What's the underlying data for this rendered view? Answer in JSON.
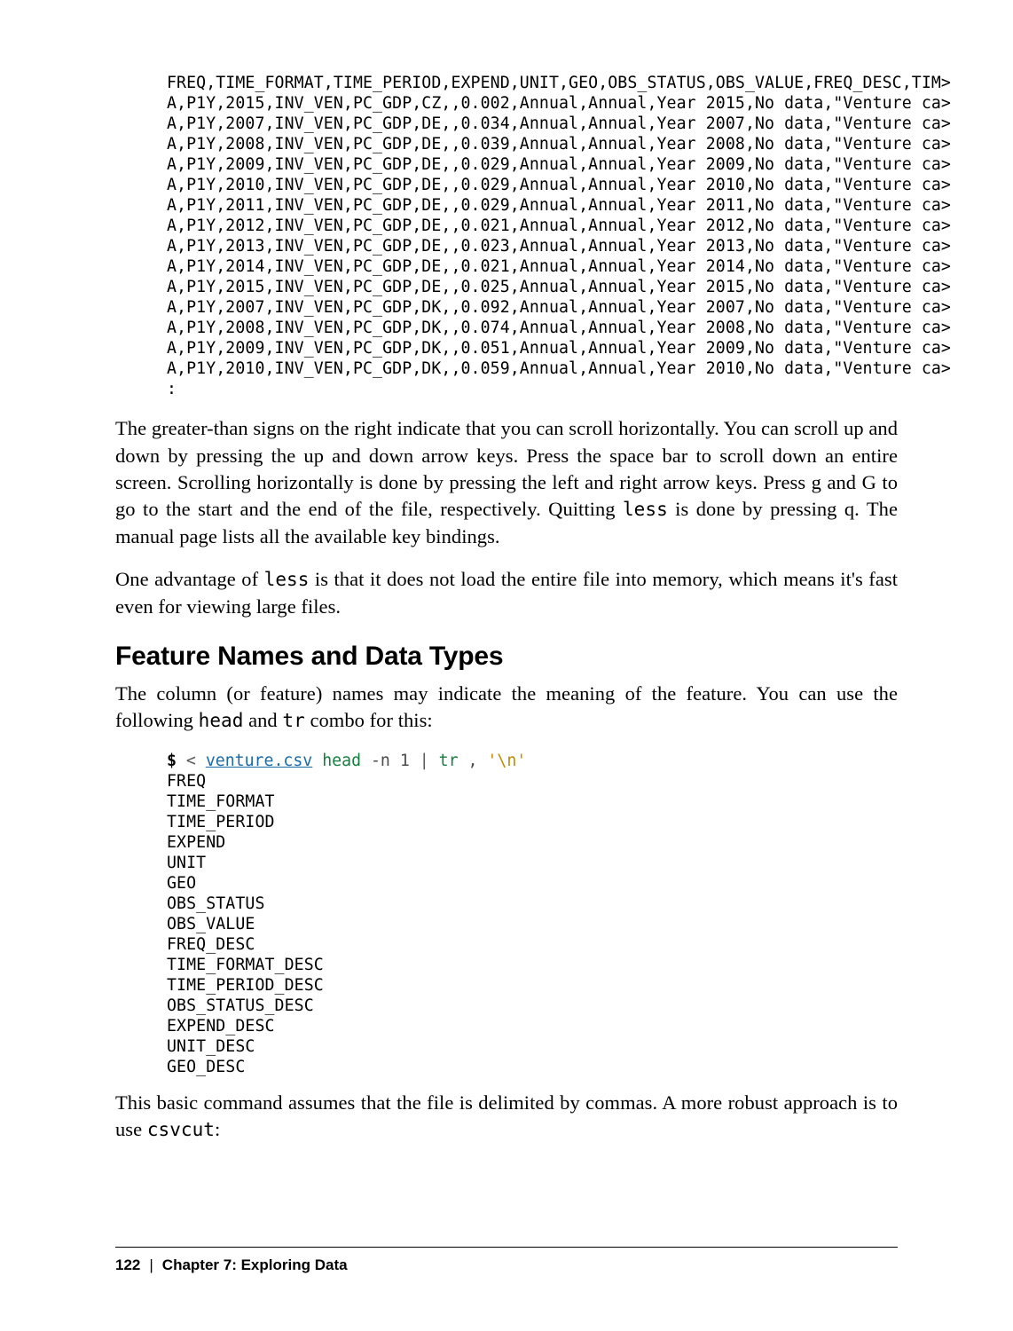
{
  "code1": "FREQ,TIME_FORMAT,TIME_PERIOD,EXPEND,UNIT,GEO,OBS_STATUS,OBS_VALUE,FREQ_DESC,TIM>\nA,P1Y,2015,INV_VEN,PC_GDP,CZ,,0.002,Annual,Annual,Year 2015,No data,\"Venture ca>\nA,P1Y,2007,INV_VEN,PC_GDP,DE,,0.034,Annual,Annual,Year 2007,No data,\"Venture ca>\nA,P1Y,2008,INV_VEN,PC_GDP,DE,,0.039,Annual,Annual,Year 2008,No data,\"Venture ca>\nA,P1Y,2009,INV_VEN,PC_GDP,DE,,0.029,Annual,Annual,Year 2009,No data,\"Venture ca>\nA,P1Y,2010,INV_VEN,PC_GDP,DE,,0.029,Annual,Annual,Year 2010,No data,\"Venture ca>\nA,P1Y,2011,INV_VEN,PC_GDP,DE,,0.029,Annual,Annual,Year 2011,No data,\"Venture ca>\nA,P1Y,2012,INV_VEN,PC_GDP,DE,,0.021,Annual,Annual,Year 2012,No data,\"Venture ca>\nA,P1Y,2013,INV_VEN,PC_GDP,DE,,0.023,Annual,Annual,Year 2013,No data,\"Venture ca>\nA,P1Y,2014,INV_VEN,PC_GDP,DE,,0.021,Annual,Annual,Year 2014,No data,\"Venture ca>\nA,P1Y,2015,INV_VEN,PC_GDP,DE,,0.025,Annual,Annual,Year 2015,No data,\"Venture ca>\nA,P1Y,2007,INV_VEN,PC_GDP,DK,,0.092,Annual,Annual,Year 2007,No data,\"Venture ca>\nA,P1Y,2008,INV_VEN,PC_GDP,DK,,0.074,Annual,Annual,Year 2008,No data,\"Venture ca>\nA,P1Y,2009,INV_VEN,PC_GDP,DK,,0.051,Annual,Annual,Year 2009,No data,\"Venture ca>\nA,P1Y,2010,INV_VEN,PC_GDP,DK,,0.059,Annual,Annual,Year 2010,No data,\"Venture ca>\n:",
  "para1_a": "The greater-than signs on the right indicate that you can scroll horizontally. You can scroll up and down by pressing the up and down arrow keys. Press the space bar to scroll down an entire screen. Scrolling horizontally is done by pressing the left and right arrow keys. Press g and G to go to the start and the end of the file, respectively. Quitting ",
  "para1_code1": "less",
  "para1_b": " is done by pressing q. The manual page lists all the available key bindings.",
  "para2_a": "One advantage of ",
  "para2_code1": "less",
  "para2_b": " is that it does not load the entire file into memory, which means it's fast even for viewing large files.",
  "heading": "Feature Names and Data Types",
  "para3_a": "The column (or feature) names may indicate the meaning of the feature. You can use the following ",
  "para3_code1": "head",
  "para3_b": " and ",
  "para3_code2": "tr",
  "para3_c": " combo for this:",
  "cmd": {
    "prompt": "$",
    "op": "<",
    "filename": "venture.csv",
    "cmd1": "head",
    "arg1": "-n 1",
    "pipe": "|",
    "cmd2": "tr",
    "arg2": ",",
    "str": "'\\n'"
  },
  "code2_out": "FREQ\nTIME_FORMAT\nTIME_PERIOD\nEXPEND\nUNIT\nGEO\nOBS_STATUS\nOBS_VALUE\nFREQ_DESC\nTIME_FORMAT_DESC\nTIME_PERIOD_DESC\nOBS_STATUS_DESC\nEXPEND_DESC\nUNIT_DESC\nGEO_DESC",
  "para4_a": "This basic command assumes that the file is delimited by commas. A more robust approach is to use ",
  "para4_code1": "csvcut",
  "para4_b": ":",
  "footer": {
    "page": "122",
    "sep": "|",
    "chapter": "Chapter 7: Exploring Data"
  }
}
